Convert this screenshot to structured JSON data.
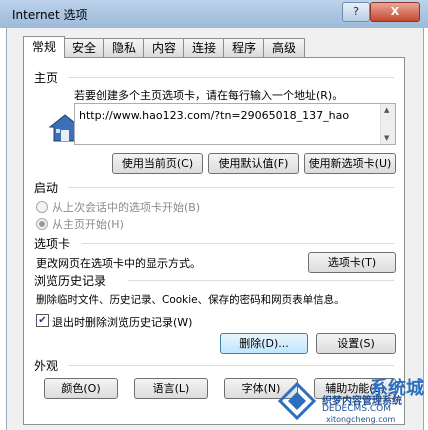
{
  "window": {
    "title": "Internet 选项",
    "help_label": "?",
    "close_label": "X"
  },
  "tabs": [
    {
      "label": "常规"
    },
    {
      "label": "安全"
    },
    {
      "label": "隐私"
    },
    {
      "label": "内容"
    },
    {
      "label": "连接"
    },
    {
      "label": "程序"
    },
    {
      "label": "高级"
    }
  ],
  "home": {
    "section": "主页",
    "description": "若要创建多个主页选项卡，请在每行输入一个地址(R)。",
    "url": "http://www.hao123.com/?tn=29065018_137_hao",
    "btn_current": "使用当前页(C)",
    "btn_default": "使用默认值(F)",
    "btn_new_tab": "使用新选项卡(U)"
  },
  "startup": {
    "section": "启动",
    "option1": "从上次会话中的选项卡开始(B)",
    "option2": "从主页开始(H)"
  },
  "tabs_section": {
    "section": "选项卡",
    "description": "更改网页在选项卡中的显示方式。",
    "button": "选项卡(T)"
  },
  "history": {
    "section": "浏览历史记录",
    "description": "删除临时文件、历史记录、Cookie、保存的密码和网页表单信息。",
    "checkbox": "退出时删除浏览历史记录(W)",
    "btn_delete": "删除(D)...",
    "btn_settings": "设置(S)"
  },
  "appearance": {
    "section": "外观",
    "btn_colors": "颜色(O)",
    "btn_languages": "语言(L)",
    "btn_fonts": "字体(N)",
    "btn_accessibility": "辅助功能(E)"
  },
  "watermark": {
    "brand": "系统城",
    "line1": "织梦内容管理系统",
    "line2": "DEDECMS.COM",
    "line3": "xitongcheng.com"
  },
  "colors": {
    "house_icon": "#3b6fb6",
    "accent": "#3c7fb1"
  }
}
